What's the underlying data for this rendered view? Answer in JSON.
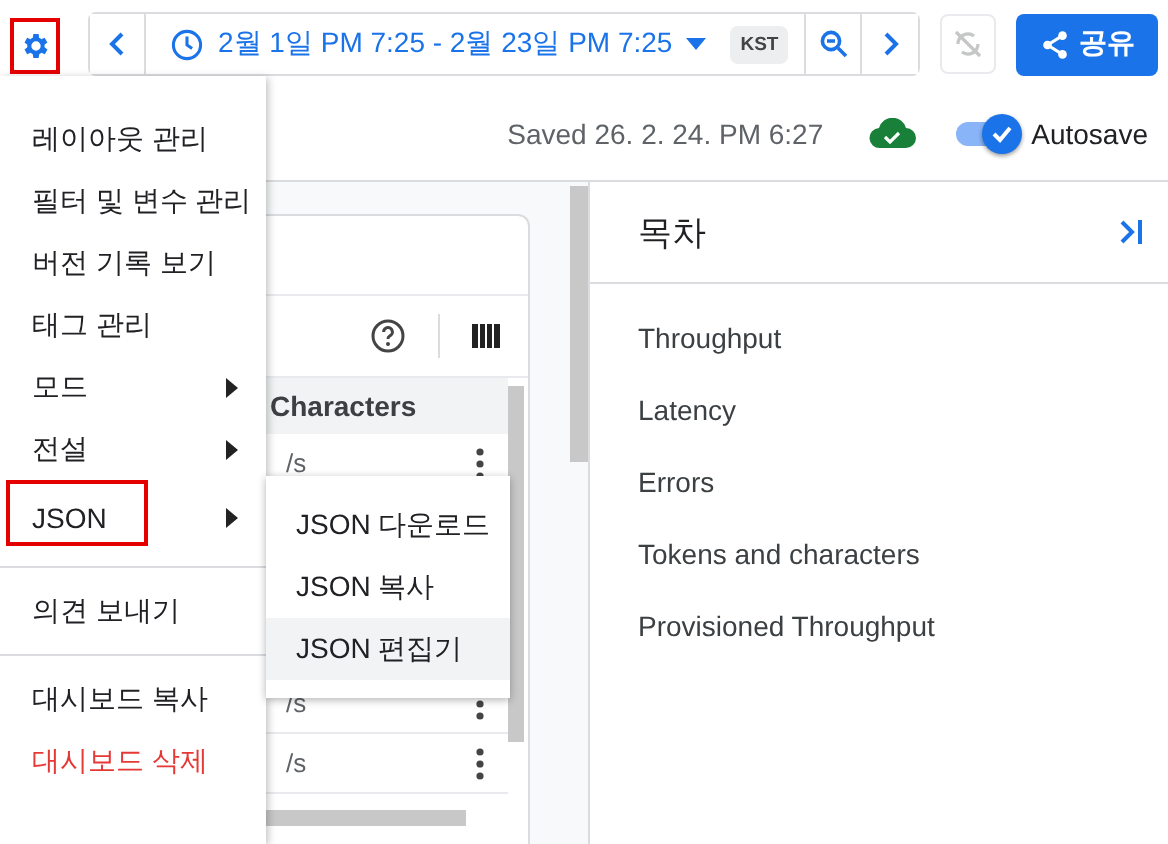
{
  "toolbar": {
    "settings_highlighted": true,
    "time_range": "2월 1일 PM 7:25 - 2월 23일 PM 7:25",
    "timezone": "KST",
    "sync_disabled": true,
    "share_label": "공유"
  },
  "status": {
    "saved": "Saved 26. 2. 24. PM 6:27",
    "synced": true,
    "autosave": {
      "label": "Autosave",
      "on": true
    }
  },
  "table": {
    "header": "Characters",
    "rows": [
      {
        "value": "/s"
      },
      {
        "value": "/s"
      },
      {
        "value": "/s"
      }
    ]
  },
  "toc": {
    "title": "목차",
    "items": [
      "Throughput",
      "Latency",
      "Errors",
      "Tokens and characters",
      "Provisioned Throughput"
    ]
  },
  "menu": {
    "groups": [
      [
        {
          "label": "레이아웃 관리",
          "kind": "item",
          "highlighted": false
        },
        {
          "label": "필터 및 변수 관리",
          "kind": "item",
          "highlighted": false
        },
        {
          "label": "버전 기록 보기",
          "kind": "item",
          "highlighted": false
        },
        {
          "label": "태그 관리",
          "kind": "item",
          "highlighted": false
        },
        {
          "label": "모드",
          "kind": "submenu",
          "highlighted": false,
          "expanded": false
        },
        {
          "label": "전설",
          "kind": "submenu",
          "highlighted": false,
          "expanded": false
        },
        {
          "label": "JSON",
          "kind": "submenu",
          "highlighted": true,
          "expanded": true
        }
      ],
      [
        {
          "label": "의견 보내기",
          "kind": "item",
          "highlighted": false
        }
      ],
      [
        {
          "label": "대시보드 복사",
          "kind": "item",
          "highlighted": false
        },
        {
          "label": "대시보드 삭제",
          "kind": "danger",
          "highlighted": false
        }
      ]
    ],
    "submenu": [
      {
        "label": "JSON 다운로드",
        "hovered": false
      },
      {
        "label": "JSON 복사",
        "hovered": false
      },
      {
        "label": "JSON 편집기",
        "hovered": true
      }
    ]
  }
}
